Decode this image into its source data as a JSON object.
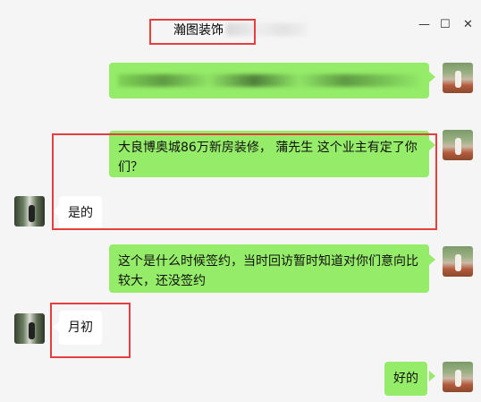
{
  "window": {
    "title": "瀚图装饰",
    "minimize_symbol": "—",
    "maximize_symbol": "☐",
    "close_symbol": "✕"
  },
  "messages": [
    {
      "sender": "me",
      "text": ""
    },
    {
      "sender": "me",
      "text": "大良博奥城86万新房装修， 蒲先生 这个业主有定了你们？"
    },
    {
      "sender": "other",
      "text": "是的"
    },
    {
      "sender": "me",
      "text": "这个是什么时候签约，当时回访暂时知道对你们意向比较大，还没签约"
    },
    {
      "sender": "other",
      "text": "月初"
    },
    {
      "sender": "me",
      "text": "好的"
    }
  ],
  "colors": {
    "background": "#f5f5f5",
    "my_bubble": "#95ec69",
    "their_bubble": "#ffffff",
    "highlight": "#e53e3e"
  },
  "icons": [
    "minimize-icon",
    "maximize-icon",
    "close-icon",
    "avatar"
  ]
}
